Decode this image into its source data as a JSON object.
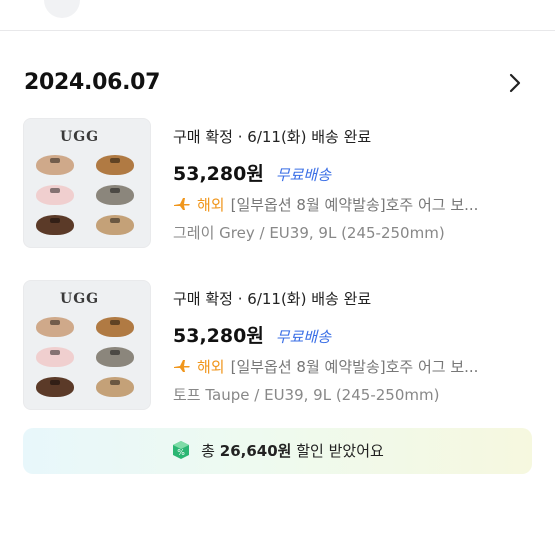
{
  "top_banner": {
    "text": "",
    "highlight": ""
  },
  "order": {
    "date": "2024.06.07",
    "chevron_icon": "chevron-right-icon"
  },
  "items": [
    {
      "status": "구매 확정 · 6/11(화) 배송 완료",
      "price": "53,280원",
      "shipping": "무료배송",
      "overseas_icon": "airplane-icon",
      "overseas": "해외",
      "title": "[일부옵션 8월 예약발송]호주 어그 보...",
      "option": "그레이 Grey / EU39, 9L (245-250mm)",
      "brand": "UGG"
    },
    {
      "status": "구매 확정 · 6/11(화) 배송 완료",
      "price": "53,280원",
      "shipping": "무료배송",
      "overseas_icon": "airplane-icon",
      "overseas": "해외",
      "title": "[일부옵션 8월 예약발송]호주 어그 보...",
      "option": "토프 Taupe / EU39, 9L (245-250mm)",
      "brand": "UGG"
    }
  ],
  "savings": {
    "icon": "discount-coin-icon",
    "prefix": "총",
    "amount": "26,640원",
    "suffix": "할인 받았어요"
  },
  "colors": {
    "shipping_blue": "#3b6fe6",
    "overseas_orange": "#f0961c",
    "savings_green": "#1fbf5a"
  }
}
